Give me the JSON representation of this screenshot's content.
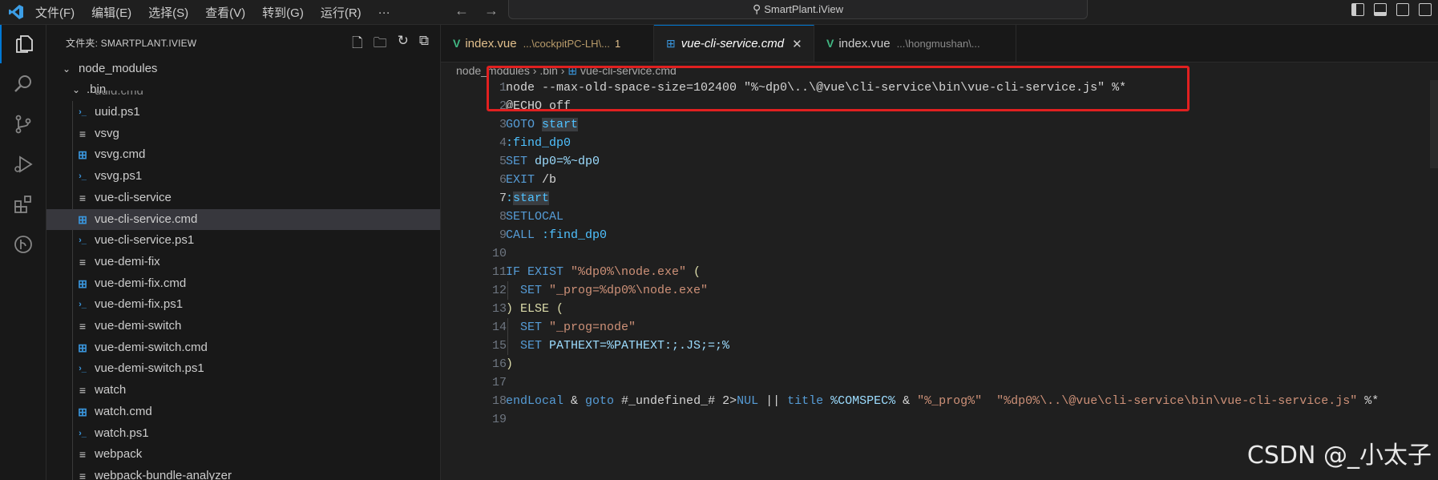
{
  "titlebar": {
    "menu": [
      "文件(F)",
      "编辑(E)",
      "选择(S)",
      "查看(V)",
      "转到(G)",
      "运行(R)",
      "···"
    ],
    "search_text": "SmartPlant.iView"
  },
  "sidebar": {
    "header": "文件夹: SMARTPLANT.IVIEW",
    "folder1": "node_modules",
    "folder2": ".bin",
    "partial": "uuid.cmd",
    "files": [
      {
        "label": "uuid.ps1",
        "icon": "ps"
      },
      {
        "label": "vsvg",
        "icon": "file"
      },
      {
        "label": "vsvg.cmd",
        "icon": "win"
      },
      {
        "label": "vsvg.ps1",
        "icon": "ps"
      },
      {
        "label": "vue-cli-service",
        "icon": "file"
      },
      {
        "label": "vue-cli-service.cmd",
        "icon": "win"
      },
      {
        "label": "vue-cli-service.ps1",
        "icon": "ps"
      },
      {
        "label": "vue-demi-fix",
        "icon": "file"
      },
      {
        "label": "vue-demi-fix.cmd",
        "icon": "win"
      },
      {
        "label": "vue-demi-fix.ps1",
        "icon": "ps"
      },
      {
        "label": "vue-demi-switch",
        "icon": "file"
      },
      {
        "label": "vue-demi-switch.cmd",
        "icon": "win"
      },
      {
        "label": "vue-demi-switch.ps1",
        "icon": "ps"
      },
      {
        "label": "watch",
        "icon": "file"
      },
      {
        "label": "watch.cmd",
        "icon": "win"
      },
      {
        "label": "watch.ps1",
        "icon": "ps"
      },
      {
        "label": "webpack",
        "icon": "file"
      },
      {
        "label": "webpack-bundle-analyzer",
        "icon": "file"
      }
    ]
  },
  "tabs": [
    {
      "label": "index.vue",
      "desc": "...\\cockpitPC-LH\\...",
      "badge": "1"
    },
    {
      "label": "vue-cli-service.cmd",
      "desc": ""
    },
    {
      "label": "index.vue",
      "desc": "...\\hongmushan\\..."
    }
  ],
  "breadcrumb": {
    "p1": "node_modules",
    "p2": ".bin",
    "p3": "vue-cli-service.cmd"
  },
  "line_numbers": [
    "1",
    "2",
    "3",
    "4",
    "5",
    "6",
    "7",
    "8",
    "9",
    "10",
    "11",
    "12",
    "13",
    "14",
    "15",
    "16",
    "17",
    "18",
    "19"
  ],
  "code": {
    "l1": "node --max-old-space-size=102400 \"%~dp0\\..\\@vue\\cli-service\\bin\\vue-cli-service.js\" %*",
    "l2": "@ECHO off",
    "l3a": "GOTO ",
    "l3b": "start",
    "l4": ":find_dp0",
    "l5a": "SET ",
    "l5b": "dp0=%~dp0",
    "l6a": "EXIT ",
    "l6b": "/b",
    "l7a": ":",
    "l7b": "start",
    "l8": "SETLOCAL",
    "l9a": "CALL ",
    "l9b": ":find_dp0",
    "l11a": "IF EXIST ",
    "l11b": "\"%dp0%\\node.exe\"",
    "l11c": " (",
    "l12a": "  SET ",
    "l12b": "\"_prog=%dp0%\\node.exe\"",
    "l13a": ") ELSE ",
    "l13b": "(",
    "l14a": "  SET ",
    "l14b": "\"_prog=node\"",
    "l15a": "  SET ",
    "l15b": "PATHEXT=%PATHEXT:;.JS;=;%",
    "l16": ")",
    "l18a": "endLocal",
    "l18b": " & ",
    "l18c": "goto",
    "l18d": " #_undefined_# 2>",
    "l18e": "NUL",
    "l18f": " || ",
    "l18g": "title",
    "l18h": " %COMSPEC%",
    "l18i": " & ",
    "l18j": "\"%_prog%\"",
    "l18k": "  \"%dp0%\\..\\@vue\\cli-service\\bin\\vue-cli-service.js\"",
    "l18l": " %*"
  },
  "watermark": "CSDN @_小太子"
}
